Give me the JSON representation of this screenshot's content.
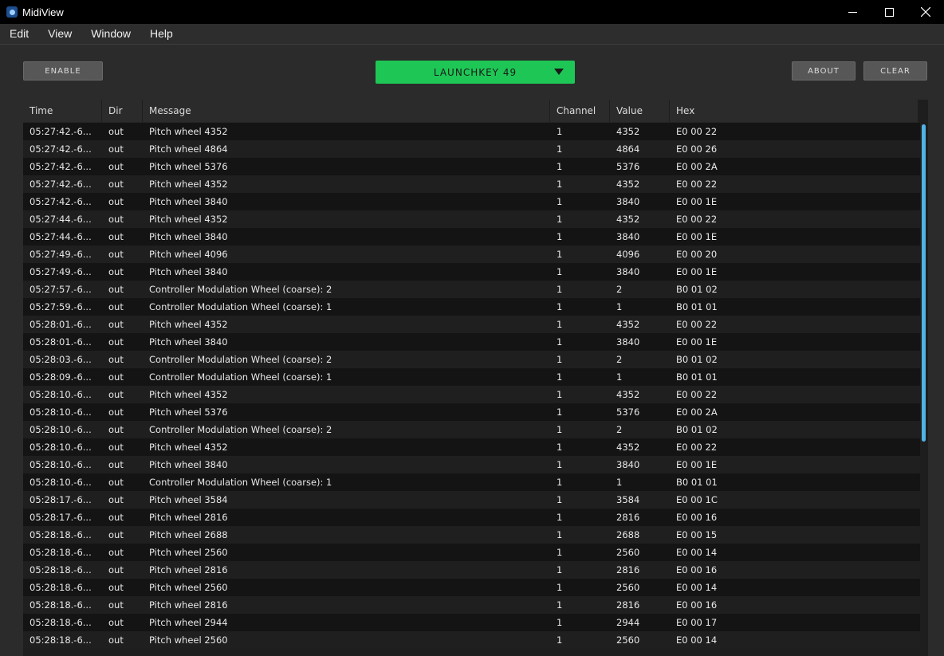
{
  "window": {
    "title": "MidiView"
  },
  "menu": [
    "Edit",
    "View",
    "Window",
    "Help"
  ],
  "toolbar": {
    "enable_label": "ENABLE",
    "device": "LAUNCHKEY 49",
    "about_label": "ABOUT",
    "clear_label": "CLEAR"
  },
  "colors": {
    "accent_green": "#1ec755",
    "scroll_thumb": "#4fb3e6"
  },
  "table": {
    "columns": [
      "Time",
      "Dir",
      "Message",
      "Channel",
      "Value",
      "Hex"
    ],
    "rows": [
      [
        "05:27:42.-6...",
        "out",
        "Pitch wheel 4352",
        "1",
        "4352",
        "E0 00 22"
      ],
      [
        "05:27:42.-6...",
        "out",
        "Pitch wheel 4864",
        "1",
        "4864",
        "E0 00 26"
      ],
      [
        "05:27:42.-6...",
        "out",
        "Pitch wheel 5376",
        "1",
        "5376",
        "E0 00 2A"
      ],
      [
        "05:27:42.-6...",
        "out",
        "Pitch wheel 4352",
        "1",
        "4352",
        "E0 00 22"
      ],
      [
        "05:27:42.-6...",
        "out",
        "Pitch wheel 3840",
        "1",
        "3840",
        "E0 00 1E"
      ],
      [
        "05:27:44.-6...",
        "out",
        "Pitch wheel 4352",
        "1",
        "4352",
        "E0 00 22"
      ],
      [
        "05:27:44.-6...",
        "out",
        "Pitch wheel 3840",
        "1",
        "3840",
        "E0 00 1E"
      ],
      [
        "05:27:49.-6...",
        "out",
        "Pitch wheel 4096",
        "1",
        "4096",
        "E0 00 20"
      ],
      [
        "05:27:49.-6...",
        "out",
        "Pitch wheel 3840",
        "1",
        "3840",
        "E0 00 1E"
      ],
      [
        "05:27:57.-6...",
        "out",
        "Controller Modulation Wheel (coarse): 2",
        "1",
        "2",
        "B0 01 02"
      ],
      [
        "05:27:59.-6...",
        "out",
        "Controller Modulation Wheel (coarse): 1",
        "1",
        "1",
        "B0 01 01"
      ],
      [
        "05:28:01.-6...",
        "out",
        "Pitch wheel 4352",
        "1",
        "4352",
        "E0 00 22"
      ],
      [
        "05:28:01.-6...",
        "out",
        "Pitch wheel 3840",
        "1",
        "3840",
        "E0 00 1E"
      ],
      [
        "05:28:03.-6...",
        "out",
        "Controller Modulation Wheel (coarse): 2",
        "1",
        "2",
        "B0 01 02"
      ],
      [
        "05:28:09.-6...",
        "out",
        "Controller Modulation Wheel (coarse): 1",
        "1",
        "1",
        "B0 01 01"
      ],
      [
        "05:28:10.-6...",
        "out",
        "Pitch wheel 4352",
        "1",
        "4352",
        "E0 00 22"
      ],
      [
        "05:28:10.-6...",
        "out",
        "Pitch wheel 5376",
        "1",
        "5376",
        "E0 00 2A"
      ],
      [
        "05:28:10.-6...",
        "out",
        "Controller Modulation Wheel (coarse): 2",
        "1",
        "2",
        "B0 01 02"
      ],
      [
        "05:28:10.-6...",
        "out",
        "Pitch wheel 4352",
        "1",
        "4352",
        "E0 00 22"
      ],
      [
        "05:28:10.-6...",
        "out",
        "Pitch wheel 3840",
        "1",
        "3840",
        "E0 00 1E"
      ],
      [
        "05:28:10.-6...",
        "out",
        "Controller Modulation Wheel (coarse): 1",
        "1",
        "1",
        "B0 01 01"
      ],
      [
        "05:28:17.-6...",
        "out",
        "Pitch wheel 3584",
        "1",
        "3584",
        "E0 00 1C"
      ],
      [
        "05:28:17.-6...",
        "out",
        "Pitch wheel 2816",
        "1",
        "2816",
        "E0 00 16"
      ],
      [
        "05:28:18.-6...",
        "out",
        "Pitch wheel 2688",
        "1",
        "2688",
        "E0 00 15"
      ],
      [
        "05:28:18.-6...",
        "out",
        "Pitch wheel 2560",
        "1",
        "2560",
        "E0 00 14"
      ],
      [
        "05:28:18.-6...",
        "out",
        "Pitch wheel 2816",
        "1",
        "2816",
        "E0 00 16"
      ],
      [
        "05:28:18.-6...",
        "out",
        "Pitch wheel 2560",
        "1",
        "2560",
        "E0 00 14"
      ],
      [
        "05:28:18.-6...",
        "out",
        "Pitch wheel 2816",
        "1",
        "2816",
        "E0 00 16"
      ],
      [
        "05:28:18.-6...",
        "out",
        "Pitch wheel 2944",
        "1",
        "2944",
        "E0 00 17"
      ],
      [
        "05:28:18.-6...",
        "out",
        "Pitch wheel 2560",
        "1",
        "2560",
        "E0 00 14"
      ]
    ]
  }
}
